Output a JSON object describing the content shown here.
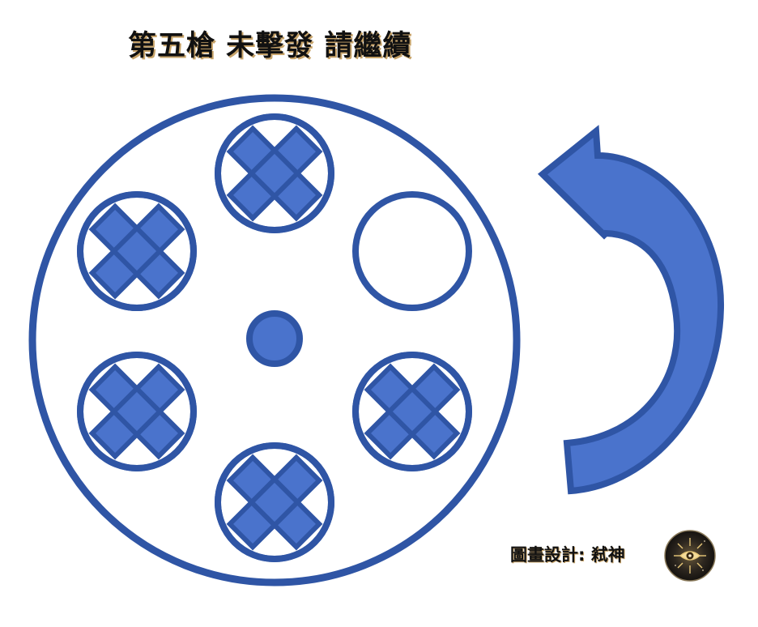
{
  "title": "第五槍 未擊發 請繼續",
  "credit": "圖畫設計: 弒神",
  "colors": {
    "stroke": "#2f55a5",
    "fill": "#4a73cc",
    "background": "#ffffff"
  },
  "cylinder": {
    "chambers": [
      {
        "position": "top",
        "state": "fired"
      },
      {
        "position": "upper-right",
        "state": "empty"
      },
      {
        "position": "lower-right",
        "state": "fired"
      },
      {
        "position": "bottom",
        "state": "fired"
      },
      {
        "position": "lower-left",
        "state": "fired"
      },
      {
        "position": "upper-left",
        "state": "fired"
      }
    ]
  },
  "icons": {
    "rotation": "counterclockwise-arrow-icon",
    "avatar": "eye-emblem-icon"
  }
}
